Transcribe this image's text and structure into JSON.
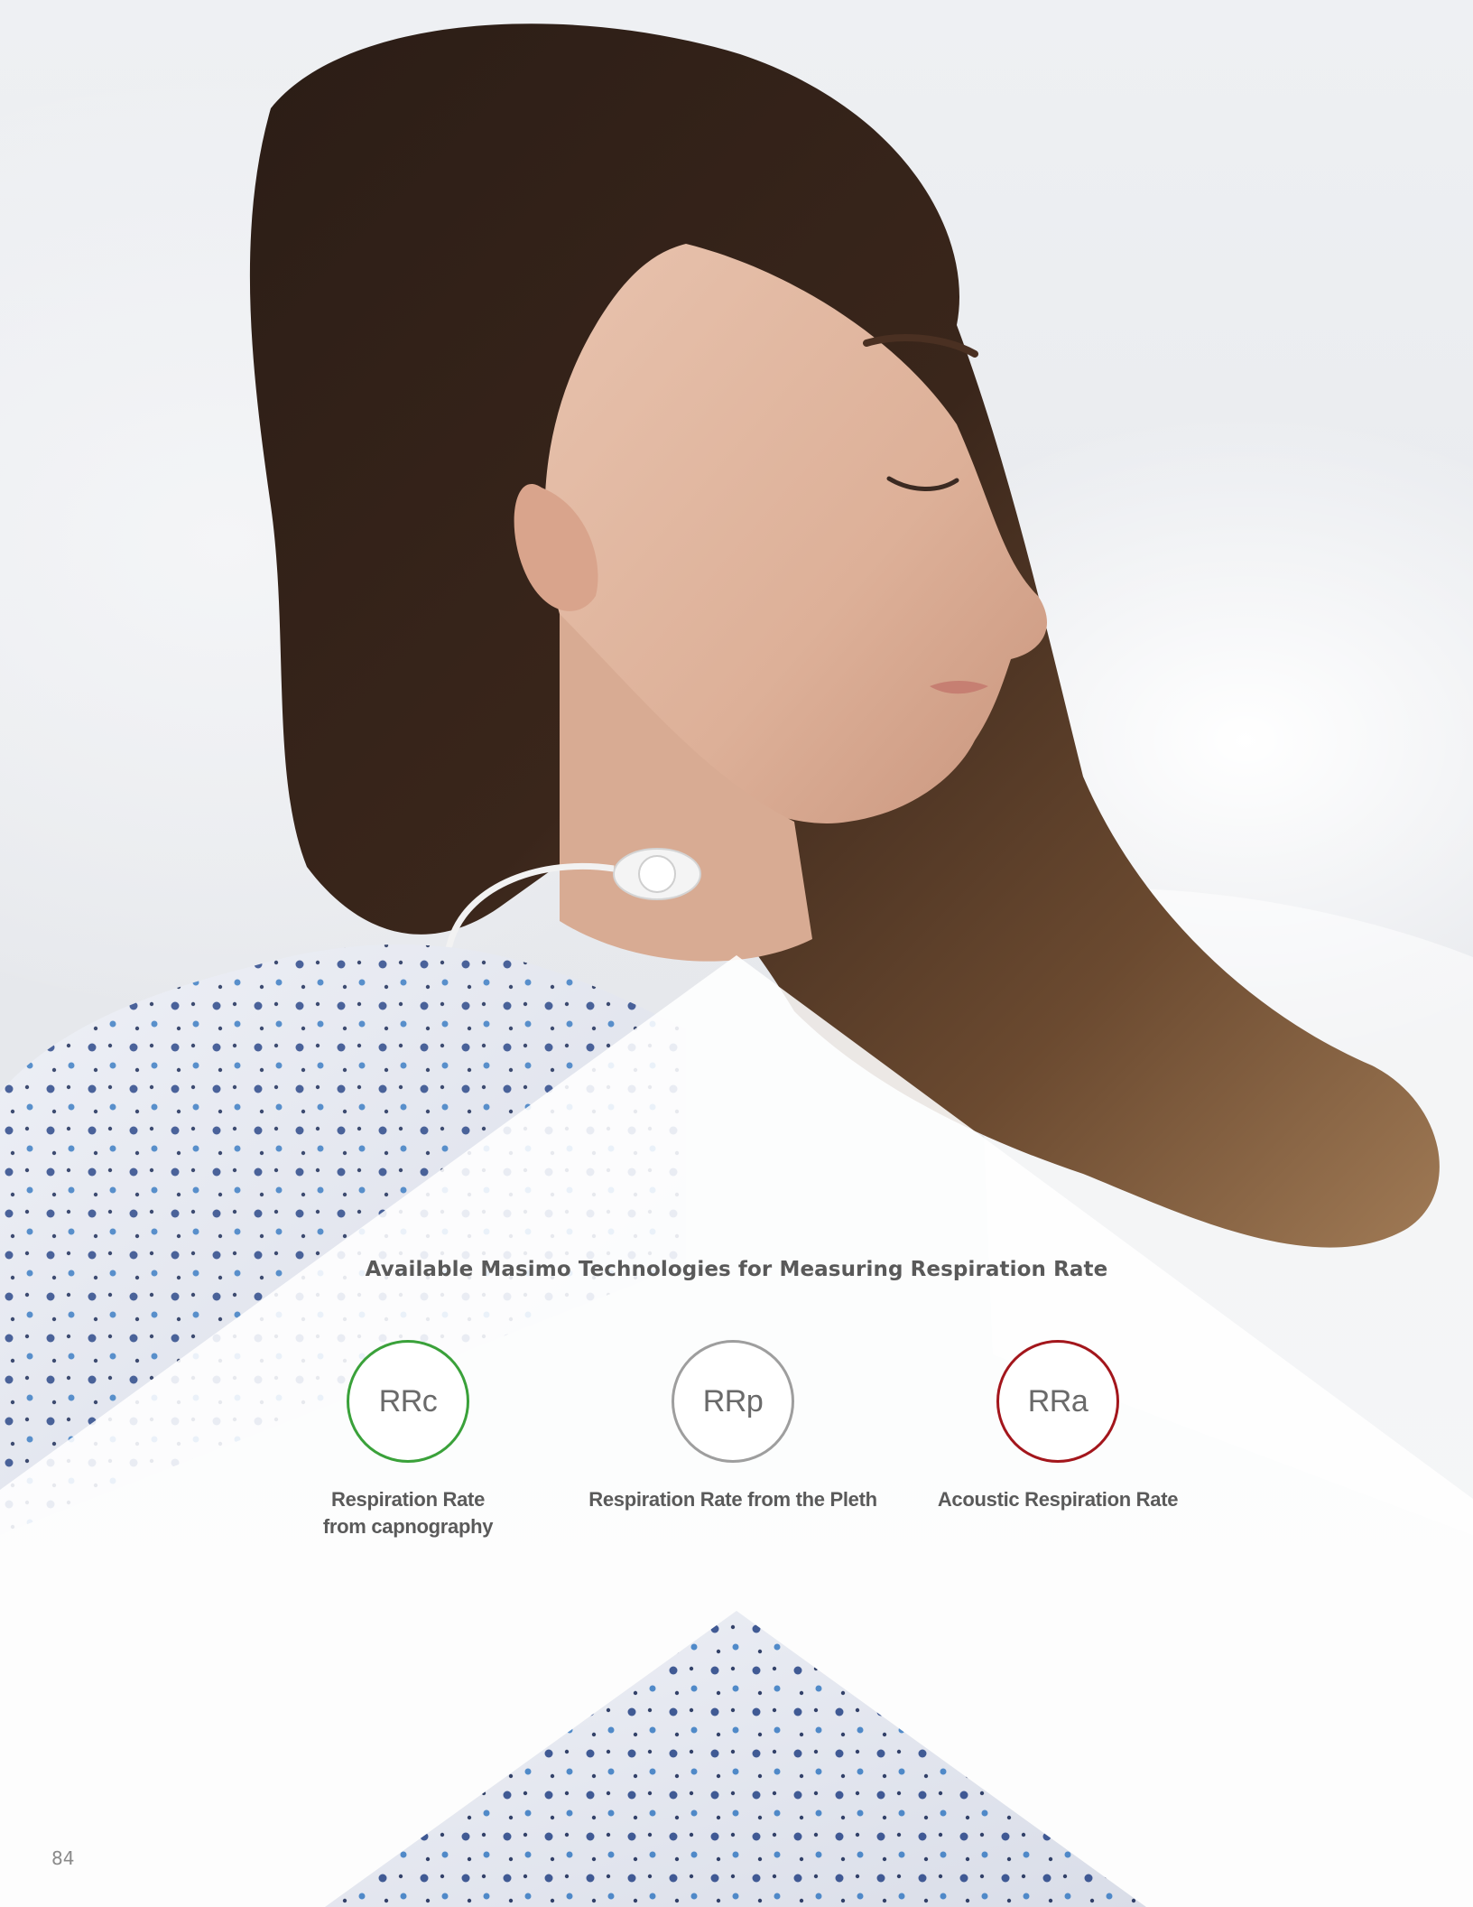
{
  "heading": "Available Masimo Technologies for Measuring Respiration Rate",
  "technologies": [
    {
      "abbr": "RRc",
      "label": "Respiration Rate from capnography",
      "color": "#3aa13a"
    },
    {
      "abbr": "RRp",
      "label": "Respiration Rate from the Pleth",
      "color": "#9e9e9e"
    },
    {
      "abbr": "RRa",
      "label": "Acoustic Respiration Rate",
      "color": "#a3161c"
    }
  ],
  "page_number": "84",
  "background_image": "photo of a woman sleeping in a hospital bed wearing a patterned hospital gown, with an acoustic respiration sensor on her neck"
}
